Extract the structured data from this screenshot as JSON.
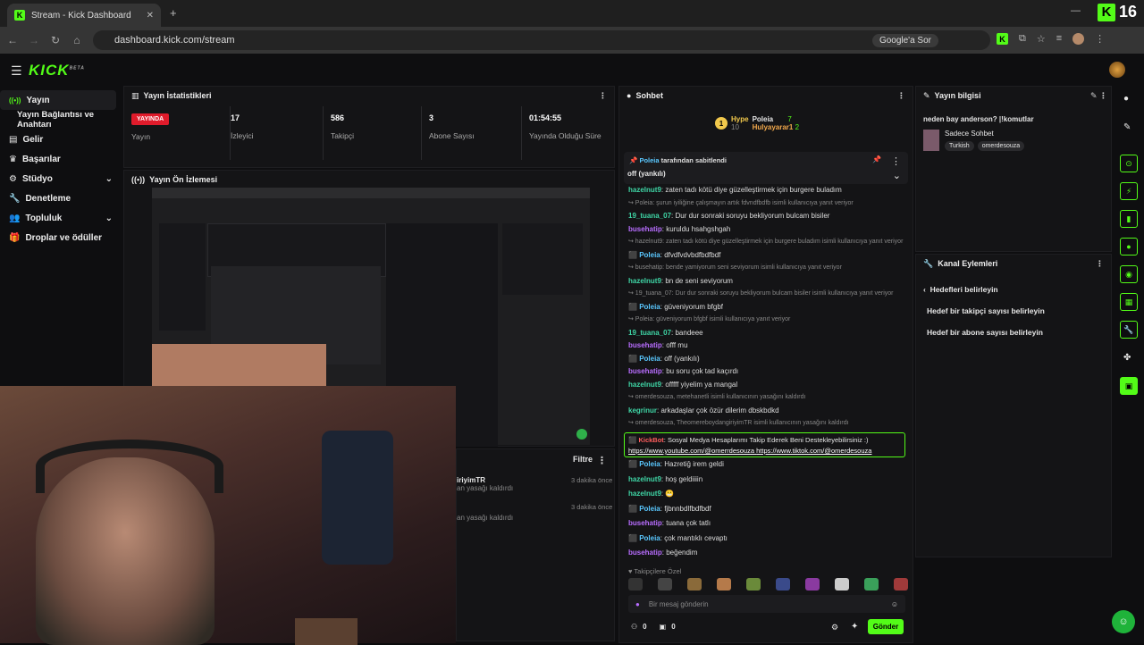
{
  "browser": {
    "tab_title": "Stream - Kick Dashboard",
    "url": "dashboard.kick.com/stream",
    "google_label": "Google'a Sor",
    "kick_badge": "16"
  },
  "brand": {
    "logo": "KICK",
    "logo_sup": "BETA",
    "accent": "#53fc18"
  },
  "sidebar": {
    "items": [
      {
        "label": "Yayın",
        "icon": "broadcast-icon"
      },
      {
        "label": "Yayın Bağlantısı ve Anahtarı",
        "icon": ""
      },
      {
        "label": "Gelir",
        "icon": "money-icon"
      },
      {
        "label": "Başarılar",
        "icon": "trophy-icon"
      },
      {
        "label": "Stüdyo",
        "icon": "studio-icon"
      },
      {
        "label": "Denetleme",
        "icon": "wrench-icon"
      },
      {
        "label": "Topluluk",
        "icon": "users-icon"
      },
      {
        "label": "Droplar ve ödüller",
        "icon": "gift-icon"
      }
    ]
  },
  "stats": {
    "title": "Yayın İstatistikleri",
    "live_badge": "YAYINDA",
    "live_label": "Yayın",
    "items": [
      {
        "value": "17",
        "label": "İzleyici"
      },
      {
        "value": "586",
        "label": "Takipçi"
      },
      {
        "value": "3",
        "label": "Abone Sayısı"
      },
      {
        "value": "01:54:55",
        "label": "Yayında Olduğu Süre"
      }
    ]
  },
  "preview": {
    "title": "Yayın Ön İzlemesi"
  },
  "activity": {
    "filter": "Filtre",
    "rows": [
      {
        "text": "iriyimTR",
        "sub": "an yasağı kaldırdı",
        "time": "3 dakika önce"
      },
      {
        "text": "",
        "sub": "an yasağı kaldırdı",
        "time": "3 dakika önce"
      }
    ]
  },
  "chat": {
    "title": "Sohbet",
    "hype_label": "Hype",
    "hype_rank": "1",
    "hype_second": "10",
    "leaders": [
      {
        "name": "Poleia",
        "count": "7"
      },
      {
        "name": "Hulyayarar1",
        "count": "2"
      }
    ],
    "pinned_by": "Poleia",
    "pinned_suffix": "tarafından sabitlendi",
    "pinned_text": "off (yankılı)",
    "messages": [
      {
        "user": "hazelnut9",
        "color": "teal",
        "text": ": zaten tadı kötü diye güzelleştirmek için burgere buladım"
      },
      {
        "sys": true,
        "text": "Poleia: şurun iyiliğine çalışmayın artık fdvndfbdfb isimli kullanıcıya yanıt veriyor"
      },
      {
        "user": "19_tuana_07",
        "color": "teal",
        "text": ": Dur dur sonraki soruyu bekliyorum bulcam bisiler"
      },
      {
        "user": "busehatip",
        "color": "purple",
        "text": ": kuruldu hsahgshgah"
      },
      {
        "sys": true,
        "text": "hazelnut9: zaten tadı kötü diye güzelleştirmek için burgere buladım isimli kullanıcıya yanıt veriyor"
      },
      {
        "user": "Poleia",
        "color": "blue",
        "text": ": dfvdfvdvbdfbdfbdf",
        "badge": true
      },
      {
        "sys": true,
        "text": "busehatip: bende yamiyorum seni seviyorum isimli kullanıcıya yanıt veriyor"
      },
      {
        "user": "hazelnut9",
        "color": "teal",
        "text": ": bn de seni seviyorum"
      },
      {
        "sys": true,
        "text": "19_tuana_07: Dur dur sonraki soruyu bekliyorum bulcam bisiler isimli kullanıcıya yanıt veriyor"
      },
      {
        "user": "Poleia",
        "color": "blue",
        "text": ": güveniyorum bfgbf",
        "badge": true
      },
      {
        "sys": true,
        "text": "Poleia: güveniyorum bfgbf isimli kullanıcıya yanıt veriyor"
      },
      {
        "user": "19_tuana_07",
        "color": "teal",
        "text": ": bandeee"
      },
      {
        "user": "busehatip",
        "color": "purple",
        "text": ": offf mu"
      },
      {
        "user": "Poleia",
        "color": "blue",
        "text": ": off (yankılı)",
        "badge": true
      },
      {
        "user": "busehatip",
        "color": "purple",
        "text": ": bu soru çok tad kaçırdı"
      },
      {
        "user": "hazelnut9",
        "color": "teal",
        "text": ": offfff yiyelim ya mangal"
      },
      {
        "sys": true,
        "text": "omerdesouza, metehanetli isimli kullanıcının yasağını kaldırdı"
      },
      {
        "user": "kegrinur",
        "color": "teal",
        "text": ": arkadaşlar çok özür dilerim dbskbdkd"
      },
      {
        "sys": true,
        "text": "omerdesouza, TheomereboydangiriyimTR isimli kullanıcının yasağını kaldırdı"
      }
    ],
    "highlight": {
      "user": "KickBot",
      "text": ": Sosyal Medya Hesaplarımı Takip Ederek Beni Destekleyebilirsiniz :)",
      "link1": "https://www.youtube.com/@omerrdesouza",
      "link2": "https://www.tiktok.com/@omerdesouza"
    },
    "messages2": [
      {
        "user": "Poleia",
        "color": "blue",
        "text": ": Hazretiğ irem geldi",
        "badge": true
      },
      {
        "user": "hazelnut9",
        "color": "teal",
        "text": ": hoş geldiiiin"
      },
      {
        "user": "hazelnut9",
        "color": "teal",
        "text": ": 😬"
      },
      {
        "user": "Poleia",
        "color": "blue",
        "text": ": fjbnnbdlfbdfbdf",
        "badge": true
      },
      {
        "user": "busehatip",
        "color": "purple",
        "text": ": tuana çok tatlı"
      },
      {
        "user": "Poleia",
        "color": "blue",
        "text": ": çok mantıklı cevaptı",
        "badge": true
      },
      {
        "user": "busehatip",
        "color": "purple",
        "text": ": beğendim"
      }
    ],
    "emote_label": "Takipçilere Özel",
    "input_placeholder": "Bir mesaj gönderin",
    "send_label": "Gönder",
    "counter1": "0",
    "counter2": "0"
  },
  "streaminfo": {
    "title": "Yayın bilgisi",
    "stream_title": "neden bay anderson? |!komutlar",
    "category": "Sadece Sohbet",
    "tags": [
      "Turkish",
      "omerdesouza"
    ]
  },
  "actions": {
    "title": "Kanal Eylemleri",
    "back_label": "Hedefleri belirleyin",
    "items": [
      "Hedef bir takipçi sayısı belirleyin",
      "Hedef bir abone sayısı belirleyin"
    ]
  }
}
